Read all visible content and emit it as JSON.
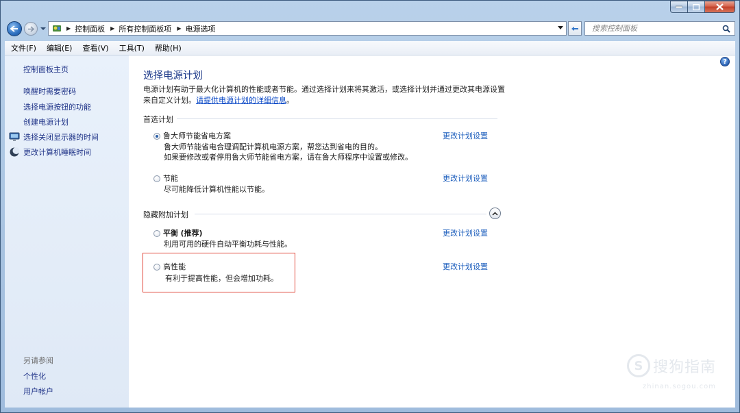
{
  "window": {
    "caption": {
      "minimize": "minimize",
      "maximize": "maximize",
      "close": "close"
    }
  },
  "address": {
    "crumbs": [
      "控制面板",
      "所有控制面板项",
      "电源选项"
    ],
    "search_placeholder": "搜索控制面板"
  },
  "menu": [
    "文件(F)",
    "编辑(E)",
    "查看(V)",
    "工具(T)",
    "帮助(H)"
  ],
  "sidebar": {
    "home": "控制面板主页",
    "links": [
      "唤醒时需要密码",
      "选择电源按钮的功能",
      "创建电源计划",
      "选择关闭显示器的时间",
      "更改计算机睡眠时间"
    ],
    "see_also": "另请参阅",
    "see_also_links": [
      "个性化",
      "用户帐户"
    ]
  },
  "main": {
    "title": "选择电源计划",
    "desc_line1": "电源计划有助于最大化计算机的性能或者节能。通过选择计划来将其激活，或选择计划并通过更改其电源设置",
    "desc_line2_prefix": "来自定义计划。",
    "desc_link": "请提供电源计划的详细信息",
    "desc_line2_suffix": "。",
    "preferred_header": "首选计划",
    "hidden_header": "隐藏附加计划",
    "change_label": "更改计划设置",
    "plans": [
      {
        "name": "鲁大师节能省电方案",
        "desc1": "鲁大师节能省电合理调配计算机电源方案，帮您达到省电的目的。",
        "desc2": "如果要修改或者停用鲁大师节能省电方案，请在鲁大师程序中设置或修改。",
        "selected": true
      },
      {
        "name": "节能",
        "desc1": "尽可能降低计算机性能以节能。",
        "selected": false
      },
      {
        "name": "平衡",
        "name_suffix": "(推荐)",
        "desc1": "利用可用的硬件自动平衡功耗与性能。",
        "selected": false
      },
      {
        "name": "高性能",
        "desc1": "有利于提高性能，但会增加功耗。",
        "selected": false
      }
    ]
  },
  "watermark": {
    "logo": "S",
    "text": "搜狗指南",
    "sub": "zhinan.sogou.com"
  },
  "colors": {
    "link": "#1e5fbd",
    "title": "#1e3a8a",
    "highlight": "#e0473a"
  }
}
